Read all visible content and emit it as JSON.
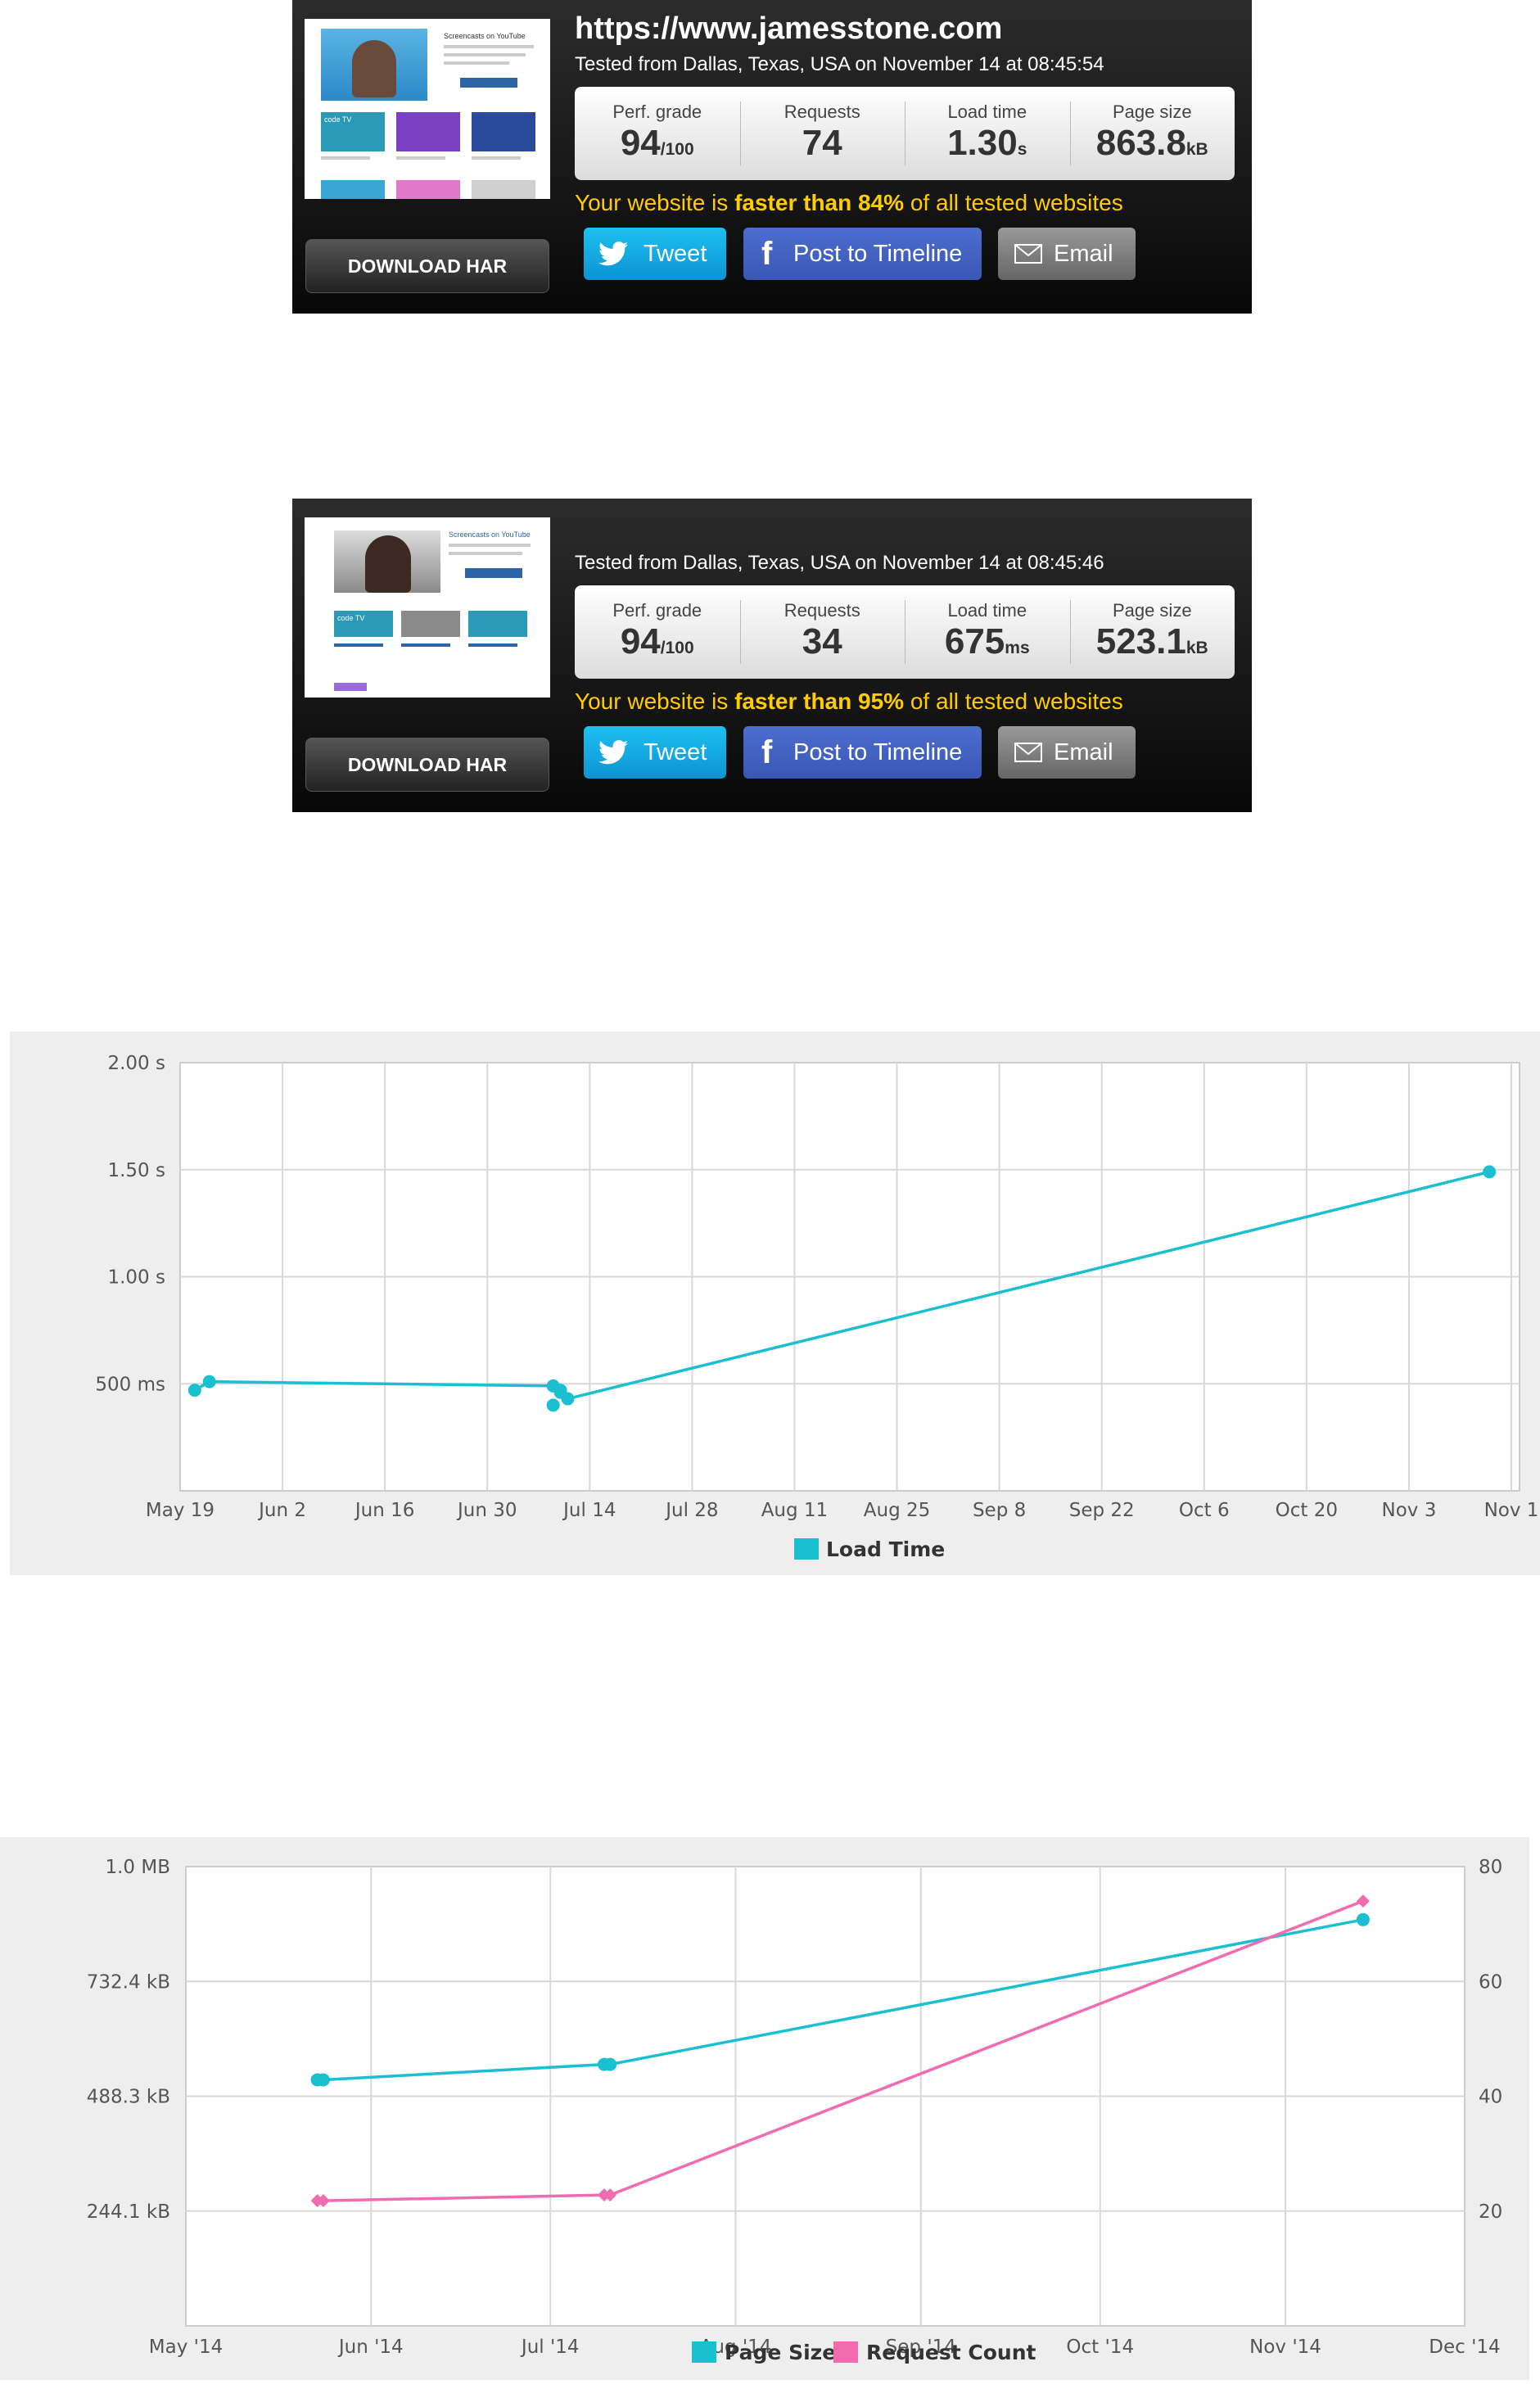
{
  "report1": {
    "url": "https://www.jamesstone.com",
    "tested": "Tested from Dallas, Texas, USA on November 14 at 08:45:54",
    "stats": [
      {
        "label": "Perf. grade",
        "value": "94",
        "unit": "/100"
      },
      {
        "label": "Requests",
        "value": "74",
        "unit": ""
      },
      {
        "label": "Load time",
        "value": "1.30",
        "unit": "s"
      },
      {
        "label": "Page size",
        "value": "863.8",
        "unit": "kB"
      }
    ],
    "faster_prefix": "Your website is ",
    "faster_bold": "faster than 84%",
    "faster_suffix": " of all tested websites",
    "download_label": "DOWNLOAD HAR",
    "tweet_label": "Tweet",
    "facebook_label": "Post to Timeline",
    "email_label": "Email"
  },
  "report2": {
    "tested": "Tested from Dallas, Texas, USA on November 14 at 08:45:46",
    "stats": [
      {
        "label": "Perf. grade",
        "value": "94",
        "unit": "/100"
      },
      {
        "label": "Requests",
        "value": "34",
        "unit": ""
      },
      {
        "label": "Load time",
        "value": "675",
        "unit": "ms"
      },
      {
        "label": "Page size",
        "value": "523.1",
        "unit": "kB"
      }
    ],
    "faster_prefix": "Your website is ",
    "faster_bold": "faster than 95%",
    "faster_suffix": " of all tested websites",
    "download_label": "DOWNLOAD HAR",
    "tweet_label": "Tweet",
    "facebook_label": "Post to Timeline",
    "email_label": "Email"
  },
  "thumb1": {
    "header": "Screencasts on YouTube",
    "tiles": [
      "code TV",
      "",
      ""
    ]
  },
  "thumb2": {
    "header": "Screencasts on YouTube",
    "tiles": [
      "code TV",
      "",
      ""
    ]
  },
  "colors": {
    "teal": "#1abfd0",
    "pink": "#f06bb0",
    "yellow": "#ffcc00",
    "tweet": "#12a9e3",
    "facebook": "#4466c4",
    "email": "#7a7a7a"
  },
  "chart_data": [
    {
      "type": "line",
      "x_tick_labels": [
        "May 19",
        "Jun 2",
        "Jun 16",
        "Jun 30",
        "Jul 14",
        "Jul 28",
        "Aug 11",
        "Aug 25",
        "Sep 8",
        "Sep 22",
        "Oct 6",
        "Oct 20",
        "Nov 3",
        "Nov 1"
      ],
      "y_tick_labels": [
        "500 ms",
        "1.00 s",
        "1.50 s",
        "2.00 s"
      ],
      "y_tick_values": [
        0.5,
        1.0,
        1.5,
        2.0
      ],
      "ylim": [
        0,
        2.0
      ],
      "legend": [
        "Load Time"
      ],
      "legend_position": "bottom",
      "grid": true,
      "series": [
        {
          "name": "Load Time",
          "color": "#1abfd0",
          "x": [
            "2014-05-21",
            "2014-05-23",
            "2014-07-09",
            "2014-07-09",
            "2014-07-10",
            "2014-07-10",
            "2014-07-11",
            "2014-11-14"
          ],
          "y": [
            0.47,
            0.51,
            0.49,
            0.4,
            0.46,
            0.47,
            0.43,
            1.49
          ]
        }
      ]
    },
    {
      "type": "line",
      "x_tick_labels": [
        "May '14",
        "Jun '14",
        "Jul '14",
        "Aug '14",
        "Sep '14",
        "Oct '14",
        "Nov '14",
        "Dec '14"
      ],
      "y_left_tick_labels": [
        "244.1 kB",
        "488.3 kB",
        "732.4 kB",
        "1.0 MB"
      ],
      "y_left_tick_values": [
        244.1,
        488.3,
        732.4,
        976.6
      ],
      "y_left_lim": [
        0,
        976.6
      ],
      "y_right_tick_labels": [
        "20",
        "40",
        "60",
        "80"
      ],
      "y_right_tick_values": [
        20,
        40,
        60,
        80
      ],
      "y_right_lim": [
        0,
        80
      ],
      "legend": [
        "Page Size",
        "Request Count"
      ],
      "legend_position": "bottom",
      "grid": true,
      "series": [
        {
          "name": "Page Size",
          "axis": "left",
          "color": "#1abfd0",
          "marker": "circle",
          "x": [
            "2014-05-23",
            "2014-05-24",
            "2014-07-10",
            "2014-07-11",
            "2014-11-14"
          ],
          "y": [
            523.1,
            523.1,
            556.0,
            556.0,
            863.8
          ]
        },
        {
          "name": "Request Count",
          "axis": "right",
          "color": "#f06bb0",
          "marker": "diamond",
          "x": [
            "2014-05-23",
            "2014-05-24",
            "2014-07-10",
            "2014-07-11",
            "2014-11-14"
          ],
          "y": [
            21.8,
            21.8,
            22.8,
            22.8,
            74
          ]
        }
      ]
    }
  ]
}
